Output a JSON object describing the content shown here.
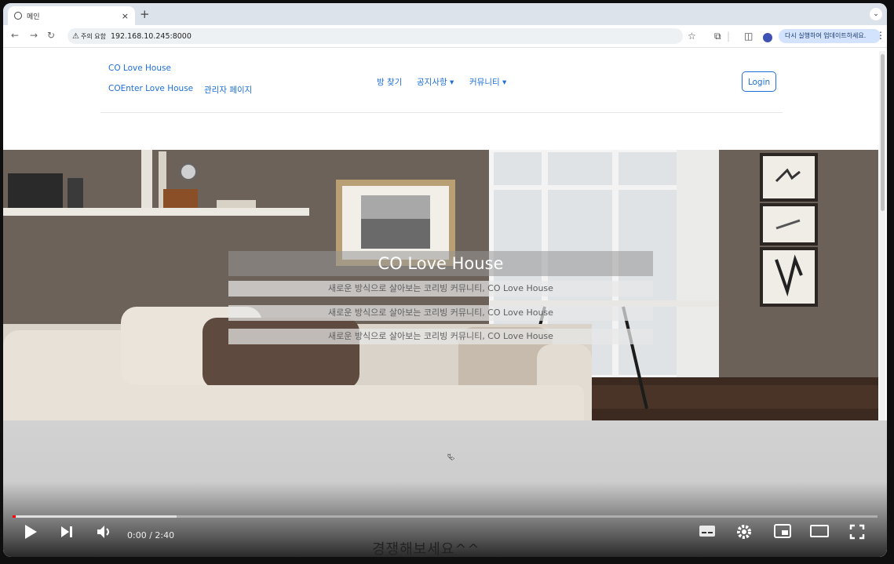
{
  "browser": {
    "tab_title": "메인",
    "tab_close": "×",
    "new_tab": "+",
    "tab_menu": "⌄",
    "warning_label": "주의 요함",
    "url": "192.168.10.245:8000",
    "update_label": "다시 실행하여 업데이트하세요."
  },
  "nav": {
    "brand_top": "CO Love House",
    "brand_bottom": "COEnter Love House",
    "admin": "관리자 페이지",
    "find_room": "방 찾기",
    "notice": "공지사항 ▾",
    "community": "커뮤니티 ▾",
    "login": "Login"
  },
  "hero": {
    "title": "CO Love House",
    "subtitles": [
      "새로운 방식으로 살아보는 코리빙 커뮤니티, CO Love House",
      "새로운 방식으로 살아보는 코리빙 커뮤니티, CO Love House",
      "새로운 방식으로 살아보는 코리빙 커뮤니티, CO Love House"
    ]
  },
  "player": {
    "time": "0:00 / 2:40",
    "progress_played": 0.003,
    "progress_buffered": 0.19,
    "overflow_text": "경쟁해보세요^^"
  },
  "icons": {
    "play": "play-icon",
    "next": "next-icon",
    "volume": "volume-icon",
    "captions": "captions-icon",
    "settings": "gear-icon",
    "miniplayer": "miniplayer-icon",
    "theater": "theater-icon",
    "fullscreen": "fullscreen-icon"
  },
  "colors": {
    "link": "#1e6fd9",
    "progress": "#ff0000",
    "hero_wall": "#6f655c"
  }
}
